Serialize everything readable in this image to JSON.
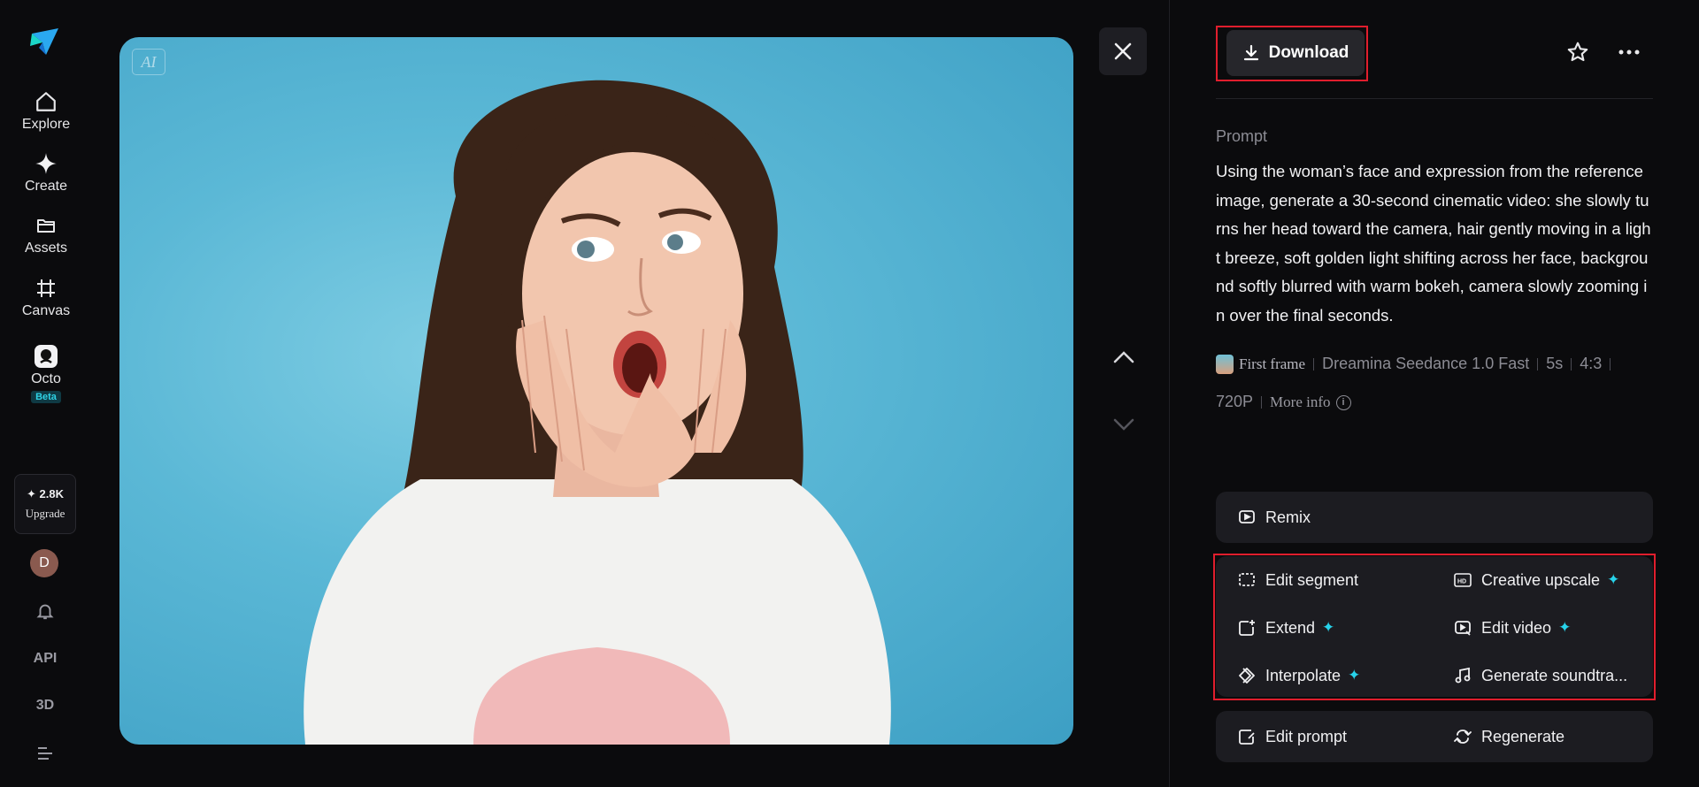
{
  "sidebar": {
    "nav": [
      {
        "label": "Explore",
        "icon": "home-icon"
      },
      {
        "label": "Create",
        "icon": "sparkle-icon"
      },
      {
        "label": "Assets",
        "icon": "folder-icon"
      },
      {
        "label": "Canvas",
        "icon": "canvas-icon"
      },
      {
        "label": "Octo",
        "icon": "octo-icon",
        "badge": "Beta"
      }
    ],
    "credits": "2.8K",
    "upgrade_label": "Upgrade",
    "avatar_initial": "D",
    "api_label": "API",
    "threed_label": "3D"
  },
  "media": {
    "ai_badge": "AI"
  },
  "panel": {
    "download_label": "Download",
    "prompt_label": "Prompt",
    "prompt_text": "Using the woman’s face and expression from the reference image, generate a 30-second cinematic video: she slowly turns her head toward the camera, hair gently moving in a light breeze, soft golden light shifting across her face, background softly blurred with warm bokeh, camera slowly zooming in over the final seconds.",
    "meta": {
      "first_frame": "First frame",
      "model": "Dreamina Seedance 1.0 Fast",
      "duration": "5s",
      "ratio": "4:3",
      "resolution": "720P",
      "more_info": "More info"
    },
    "actions": {
      "remix": "Remix",
      "edit_segment": "Edit segment",
      "creative_upscale": "Creative upscale",
      "extend": "Extend",
      "edit_video": "Edit video",
      "interpolate": "Interpolate",
      "generate_soundtrack": "Generate soundtra...",
      "edit_prompt": "Edit prompt",
      "regenerate": "Regenerate"
    }
  },
  "colors": {
    "accent": "#27d2ea",
    "highlight": "#e01e2d",
    "background": "#0b0b0d"
  }
}
